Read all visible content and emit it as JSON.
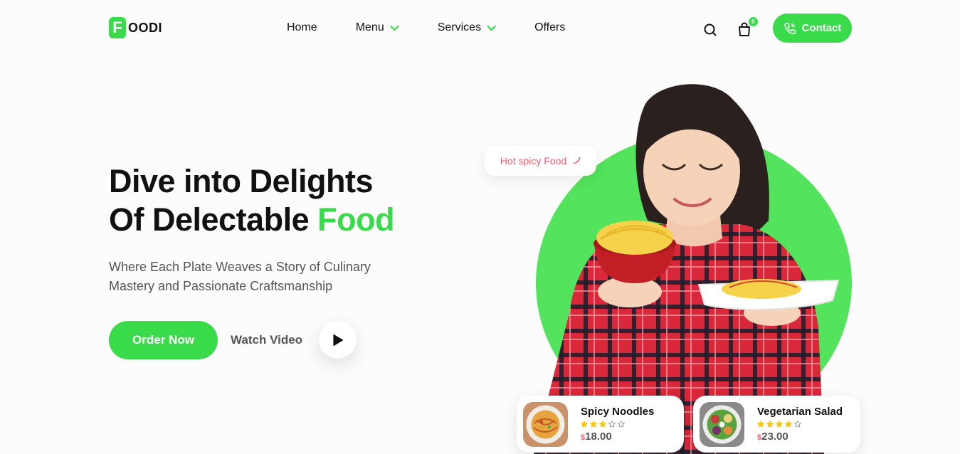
{
  "brand": {
    "logo_letter": "F",
    "logo_rest": "OODI",
    "accent": "#39db4a",
    "red_accent": "#f0616d"
  },
  "nav": {
    "items": [
      {
        "label": "Home",
        "has_dropdown": false
      },
      {
        "label": "Menu",
        "has_dropdown": true
      },
      {
        "label": "Services",
        "has_dropdown": true
      },
      {
        "label": "Offers",
        "has_dropdown": false
      }
    ]
  },
  "header": {
    "cart_count": "0",
    "contact_label": "Contact",
    "icons": [
      "search-icon",
      "cart-icon",
      "phone-icon"
    ]
  },
  "hero": {
    "headline_line1": "Dive into Delights",
    "headline_line2_prefix": "Of Delectable ",
    "headline_line2_accent": "Food",
    "subtitle_line1": "Where Each Plate Weaves a Story of Culinary",
    "subtitle_line2": "Mastery and Passionate Craftsmanship",
    "order_button": "Order Now",
    "watch_label": "Watch Video",
    "badge": "Hot spicy Food"
  },
  "cards": [
    {
      "name": "Spicy Noodles",
      "rating": 3,
      "max_rating": 5,
      "currency": "$",
      "price": "18.00"
    },
    {
      "name": "Vegetarian Salad",
      "rating": 4,
      "max_rating": 5,
      "currency": "$",
      "price": "23.00"
    }
  ]
}
